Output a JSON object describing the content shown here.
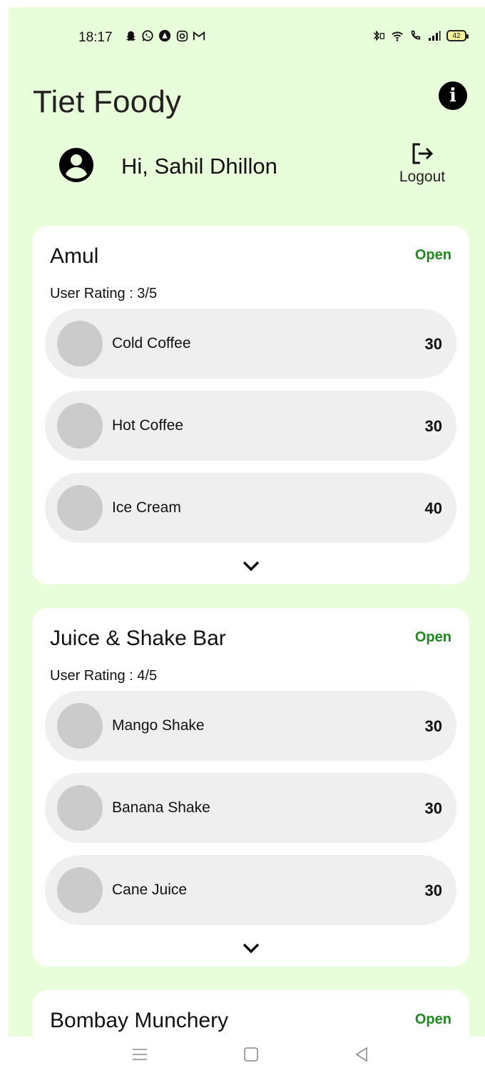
{
  "status_bar": {
    "time": "18:17",
    "battery": "42",
    "left_icons": [
      "snapchat-icon",
      "whatsapp-icon",
      "app-icon",
      "instagram-icon",
      "gmail-icon"
    ],
    "right_icons": [
      "bluetooth-icon",
      "wifi-icon",
      "call-icon",
      "signal-icon",
      "battery-icon"
    ]
  },
  "app": {
    "title": "Tiet Foody"
  },
  "user": {
    "greeting": "Hi, Sahil Dhillon",
    "logout_label": "Logout"
  },
  "colors": {
    "background": "#e8fdd9",
    "open_status": "#1e8a1e",
    "card": "#ffffff",
    "item_pill": "#efefef",
    "thumb": "#cbcbcb"
  },
  "shops": [
    {
      "name": "Amul",
      "status": "Open",
      "rating": "User Rating : 3/5",
      "items": [
        {
          "name": "Cold Coffee",
          "price": "30"
        },
        {
          "name": "Hot Coffee",
          "price": "30"
        },
        {
          "name": "Ice Cream",
          "price": "40"
        }
      ]
    },
    {
      "name": "Juice & Shake Bar",
      "status": "Open",
      "rating": "User Rating : 4/5",
      "items": [
        {
          "name": "Mango Shake",
          "price": "30"
        },
        {
          "name": "Banana Shake",
          "price": "30"
        },
        {
          "name": "Cane Juice",
          "price": "30"
        }
      ]
    },
    {
      "name": "Bombay Munchery",
      "status": "Open"
    }
  ],
  "nav_bar": {
    "icons": [
      "menu-icon",
      "home-icon",
      "back-icon"
    ]
  }
}
